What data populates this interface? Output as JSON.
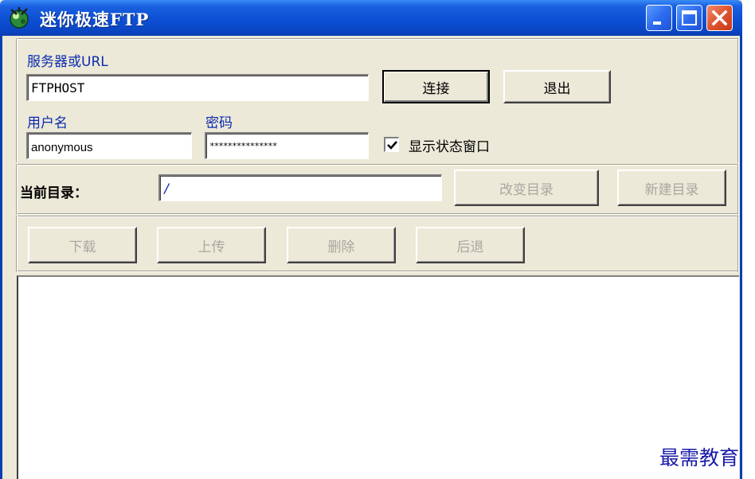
{
  "window": {
    "title": "迷你极速FTP",
    "title_bar_color": "#0d4fd4",
    "buttons": [
      "minimize-icon",
      "maximize-icon",
      "close-icon"
    ]
  },
  "server": {
    "label": "服务器或URL",
    "value": "FTPHOST"
  },
  "connect_button": "连接",
  "exit_button": "退出",
  "username": {
    "label": "用户名",
    "value": "anonymous"
  },
  "password": {
    "label": "密码",
    "value": "***************"
  },
  "show_status": {
    "label": "显示状态窗口",
    "checked": true
  },
  "directory": {
    "label": "当前目录：",
    "value": "/",
    "change_button": "改变目录",
    "new_button": "新建目录"
  },
  "toolbar": {
    "download": "下载",
    "upload": "上传",
    "delete": "删除",
    "back": "后退"
  },
  "watermark": "最需教育",
  "colors": {
    "label_blue": "#0b2bb0",
    "disabled_text": "#a8a8a0",
    "face": "#ece9d8"
  }
}
